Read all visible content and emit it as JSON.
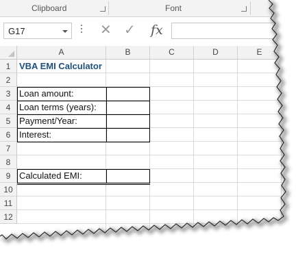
{
  "ribbon": {
    "groups": [
      {
        "label": "Clipboard"
      },
      {
        "label": "Font"
      }
    ]
  },
  "formula_bar": {
    "name_box_value": "G17",
    "cancel_icon": "cancel-x-icon",
    "enter_icon": "checkmark-icon",
    "function_label": "fx",
    "formula_value": ""
  },
  "sheet": {
    "columns": [
      "A",
      "B",
      "C",
      "D",
      "E"
    ],
    "rows": [
      "1",
      "2",
      "3",
      "4",
      "5",
      "6",
      "7",
      "8",
      "9",
      "10",
      "11",
      "12"
    ],
    "title": "VBA EMI Calculator",
    "labels": {
      "loan_amount": "Loan amount:",
      "loan_terms": "Loan terms (years):",
      "payment_year": "Payment/Year:",
      "interest": "Interest:",
      "calculated_emi": "Calculated EMI:"
    },
    "colors": {
      "title": "#1f4e79",
      "header_bg": "#f2f2f2",
      "gridline": "#dadada"
    }
  }
}
